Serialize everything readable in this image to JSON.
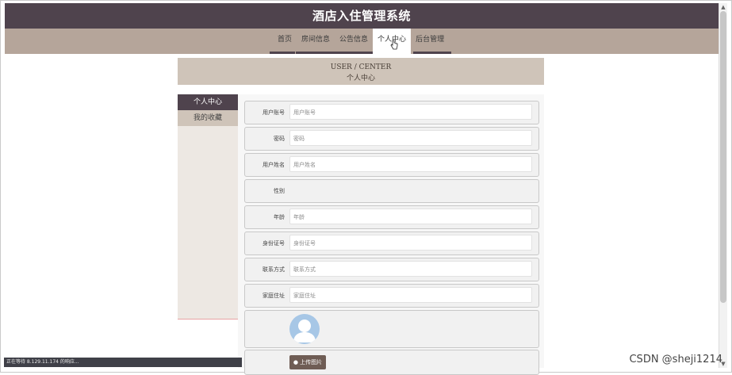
{
  "header": {
    "title": "酒店入住管理系统"
  },
  "nav": {
    "items": [
      {
        "label": "首页"
      },
      {
        "label": "房间信息"
      },
      {
        "label": "公告信息"
      },
      {
        "label": "个人中心"
      },
      {
        "label": "后台管理"
      }
    ],
    "active_index": 3
  },
  "center": {
    "title_en": "USER / CENTER",
    "title_zh": "个人中心"
  },
  "sidebar": {
    "items": [
      {
        "label": "个人中心"
      },
      {
        "label": "我的收藏"
      }
    ]
  },
  "form": {
    "fields": [
      {
        "label": "用户账号",
        "placeholder": "用户账号"
      },
      {
        "label": "密码",
        "placeholder": "密码"
      },
      {
        "label": "用户姓名",
        "placeholder": "用户姓名"
      },
      {
        "label": "性别",
        "placeholder": ""
      },
      {
        "label": "年龄",
        "placeholder": "年龄"
      },
      {
        "label": "身份证号",
        "placeholder": "身份证号"
      },
      {
        "label": "联系方式",
        "placeholder": "联系方式"
      },
      {
        "label": "家庭住址",
        "placeholder": "家庭住址"
      }
    ],
    "upload_label": "上传图片"
  },
  "status_bar": {
    "text": "正在等待 8.129.11.174 的响应..."
  },
  "watermark": {
    "text": "CSDN @sheji1214"
  },
  "colors": {
    "header_bg": "#4f434d",
    "nav_bg": "#b5a59a",
    "panel_bg": "#cfc4b9"
  }
}
